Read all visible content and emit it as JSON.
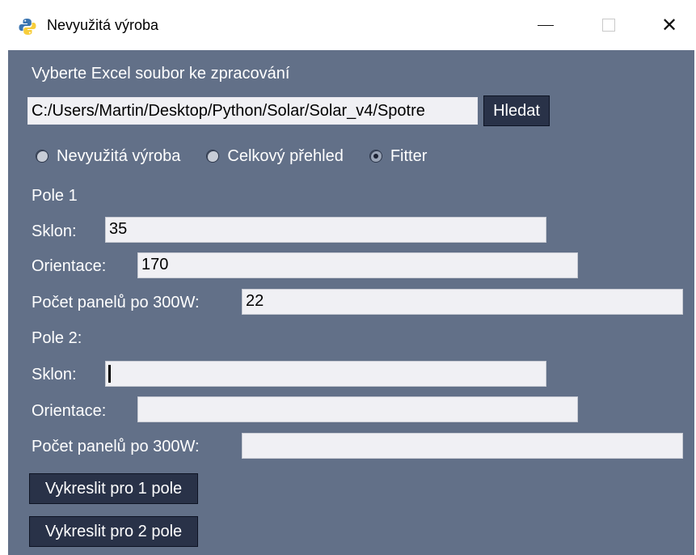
{
  "window": {
    "title": "Nevyužitá výroba",
    "icon": "python-icon",
    "controls": {
      "minimize_icon": "minimize-icon",
      "maximize_icon": "maximize-icon",
      "close_symbol": "✕"
    }
  },
  "form": {
    "select_file_label": "Vyberte Excel soubor ke zpracování",
    "file_path_value": "C:/Users/Martin/Desktop/Python/Solar/Solar_v4/Spotre",
    "browse_button": "Hledat",
    "modes": [
      {
        "label": "Nevyužitá výroba",
        "selected": false
      },
      {
        "label": "Celkový přehled",
        "selected": false
      },
      {
        "label": "Fitter",
        "selected": true
      }
    ],
    "field1": {
      "heading": "Pole 1",
      "tilt_label": "Sklon:",
      "tilt_value": "35",
      "orientation_label": "Orientace:",
      "orientation_value": "170",
      "panels_label": "Počet panelů po 300W:",
      "panels_value": "22"
    },
    "field2": {
      "heading": "Pole 2:",
      "tilt_label": "Sklon:",
      "tilt_value": "",
      "orientation_label": "Orientace:",
      "orientation_value": "",
      "panels_label": "Počet panelů po 300W:",
      "panels_value": ""
    },
    "plot1_button": "Vykreslit pro 1 pole",
    "plot2_button": "Vykreslit pro 2 pole"
  },
  "colors": {
    "background": "#627088",
    "button": "#293248",
    "entry": "#f0f0f4"
  }
}
